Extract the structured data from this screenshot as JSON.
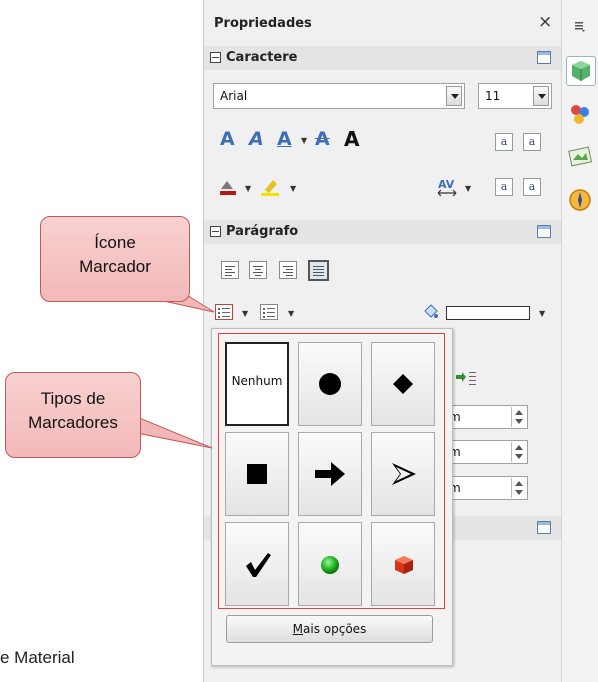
{
  "panel": {
    "title": "Propriedades",
    "close_glyph": "×",
    "character": {
      "label": "Caractere",
      "font_name": "Arial",
      "font_size": "11",
      "size_grow_glyph": "a",
      "size_shrink_glyph": "a",
      "superscript_glyph": "a",
      "subscript_glyph": "a"
    },
    "paragraph": {
      "label": "Parágrafo"
    },
    "spin_values": [
      "m",
      "m",
      "m"
    ]
  },
  "popup": {
    "cells": [
      {
        "name": "bullet-none",
        "label": "Nenhum"
      },
      {
        "name": "bullet-circle",
        "label": ""
      },
      {
        "name": "bullet-diamond",
        "label": ""
      },
      {
        "name": "bullet-square",
        "label": ""
      },
      {
        "name": "bullet-arrow",
        "label": ""
      },
      {
        "name": "bullet-pointer",
        "label": ""
      },
      {
        "name": "bullet-check",
        "label": ""
      },
      {
        "name": "bullet-green-ball",
        "label": ""
      },
      {
        "name": "bullet-red-cube",
        "label": ""
      }
    ],
    "more_options": "Mais opções"
  },
  "callouts": {
    "icon_label_line1": "Ícone",
    "icon_label_line2": "Marcador",
    "types_label_line1": "Tipos de",
    "types_label_line2": "Marcadores"
  },
  "footer_text": "e Material",
  "colors": {
    "callout_fill": "#f2b8b8",
    "callout_border": "#c05a5a",
    "grid_highlight": "#e0443f",
    "icon_blue": "#3e6fb5"
  }
}
